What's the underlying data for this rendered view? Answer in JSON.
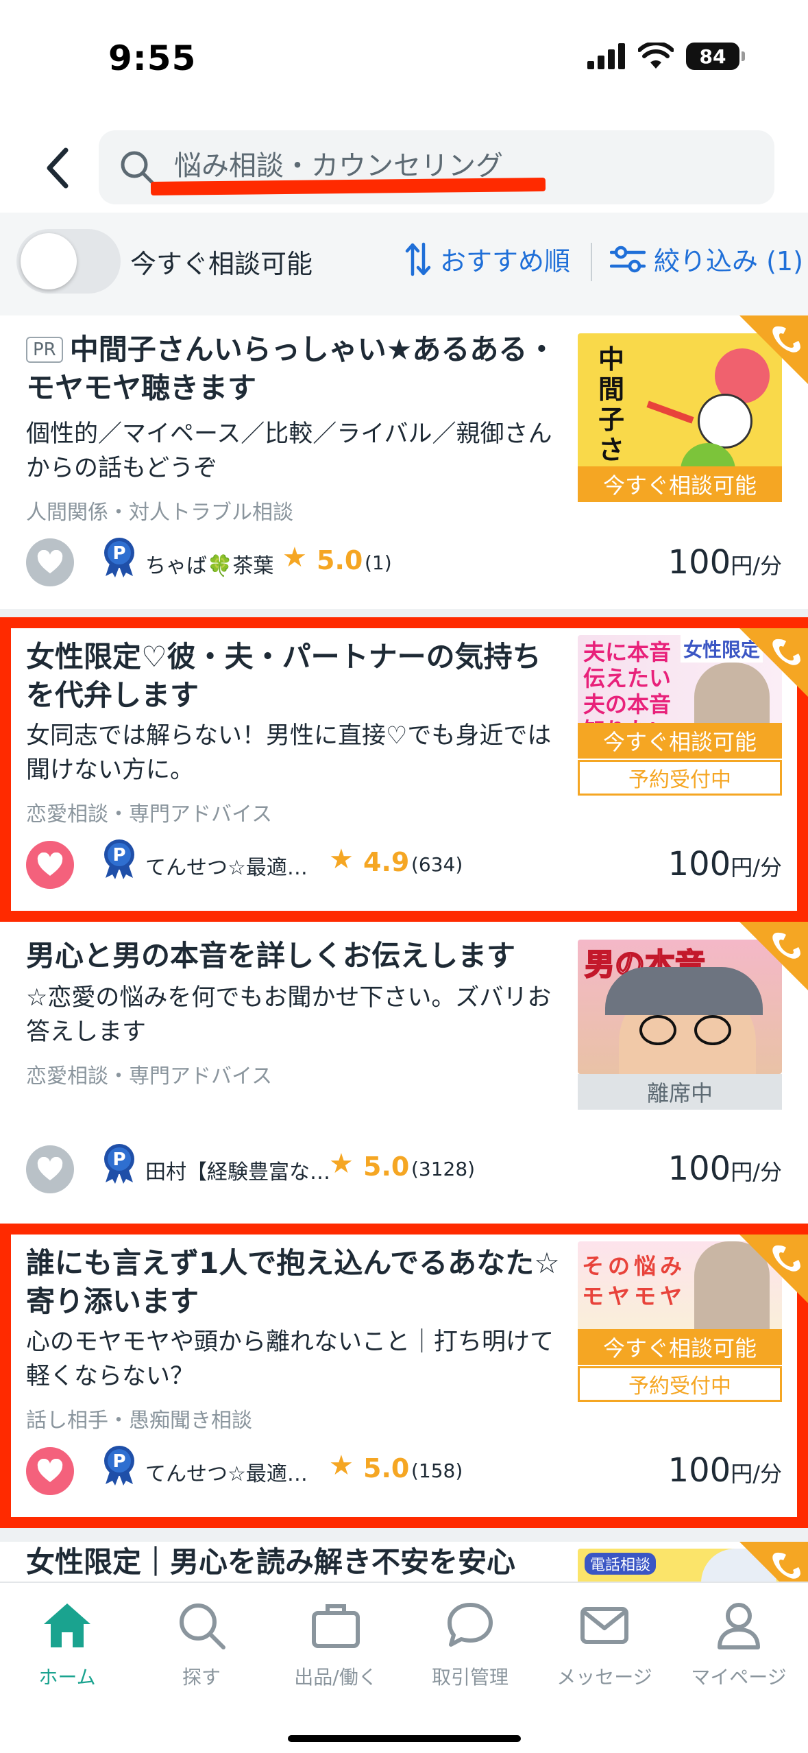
{
  "status_bar": {
    "time": "9:55",
    "battery": "84"
  },
  "search": {
    "query": "悩み相談・カウンセリング"
  },
  "filters": {
    "toggle_label": "今すぐ相談可能",
    "sort_label": "おすすめ順",
    "refine_label": "絞り込み (1)"
  },
  "cards": [
    {
      "pr": "PR",
      "title": "中間子さんいらっしゃい★あるある・モヤモヤ聴きます",
      "description": "個性的／マイペース／比較／ライバル／親御さんからの話もどうぞ",
      "category": "人間関係・対人トラブル相談",
      "seller": "ちゃば🍀茶葉",
      "rating": "5.0",
      "review_count": "(1)",
      "price": "100",
      "price_unit": "円/分",
      "status": "今すぐ相談可能",
      "favorited": false,
      "thumb_text": "中間子さん"
    },
    {
      "title": "女性限定♡彼・夫・パートナーの気持ちを代弁します",
      "description": "女同志では解らない！男性に直接♡でも身近では聞けない方に。",
      "category": "恋愛相談・専門アドバイス",
      "seller": "てんせつ☆最適…",
      "rating": "4.9",
      "review_count": "(634)",
      "price": "100",
      "price_unit": "円/分",
      "status": "今すぐ相談可能",
      "reserve": "予約受付中",
      "favorited": true,
      "thumb_text": "夫に本音伝えたい 夫の本音知りたい",
      "thumb_tag": "女性限定"
    },
    {
      "title": "男心と男の本音を詳しくお伝えします",
      "description": "☆恋愛の悩みを何でもお聞かせ下さい。ズバリお答えします",
      "category": "恋愛相談・専門アドバイス",
      "seller": "田村【経験豊富な…",
      "rating": "5.0",
      "review_count": "(3128)",
      "price": "100",
      "price_unit": "円/分",
      "status": "離席中",
      "favorited": false,
      "thumb_text": "男の本音"
    },
    {
      "title": "誰にも言えず1人で抱え込んでるあなた☆寄り添います",
      "description": "心のモヤモヤや頭から離れないこと｜打ち明けて軽くならない？",
      "category": "話し相手・愚痴聞き相談",
      "seller": "てんせつ☆最適…",
      "rating": "5.0",
      "review_count": "(158)",
      "price": "100",
      "price_unit": "円/分",
      "status": "今すぐ相談可能",
      "reserve": "予約受付中",
      "favorited": true,
      "thumb_text": "その悩み モヤモヤ"
    },
    {
      "title": "女性限定｜男心を読み解き不安を安心",
      "thumb_tag": "電話相談"
    }
  ],
  "nav": [
    {
      "label": "ホーム",
      "icon": "home-icon",
      "active": true
    },
    {
      "label": "探す",
      "icon": "search-icon"
    },
    {
      "label": "出品/働く",
      "icon": "briefcase-icon"
    },
    {
      "label": "取引管理",
      "icon": "chat-bubble-icon"
    },
    {
      "label": "メッセージ",
      "icon": "mail-icon"
    },
    {
      "label": "マイページ",
      "icon": "person-icon"
    }
  ],
  "colors": {
    "accent": "#1f6fd8",
    "highlight": "#ff2a00",
    "star": "#f5a623",
    "favorite": "#f4617c",
    "nav_active": "#1aa38f"
  }
}
